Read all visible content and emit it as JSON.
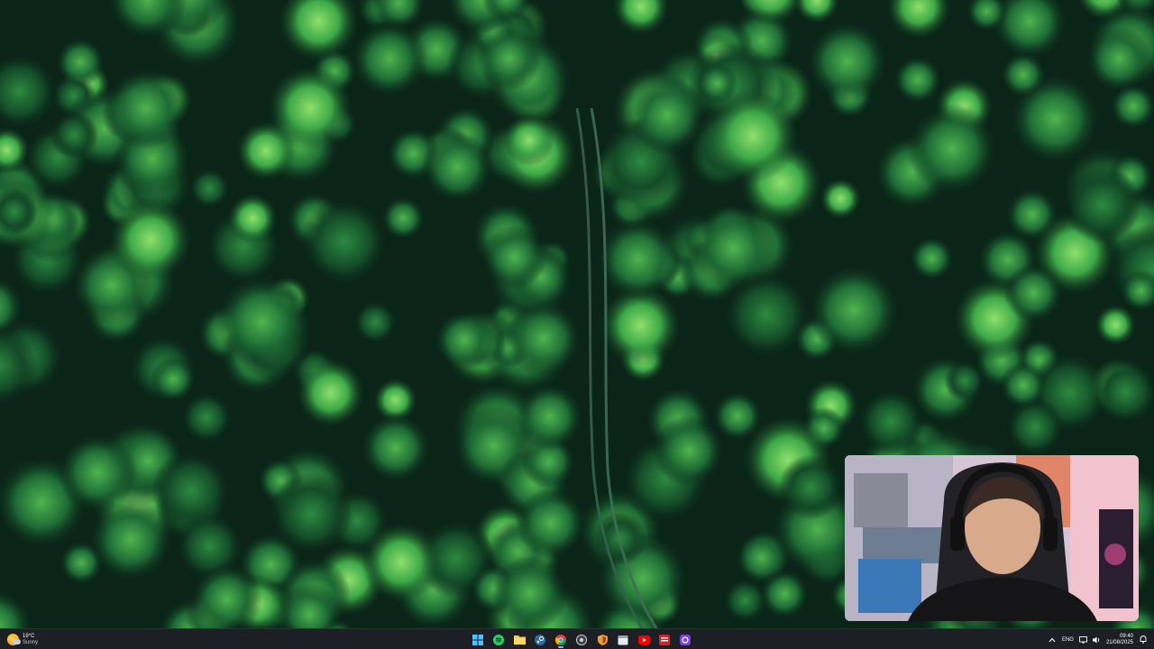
{
  "desktop": {
    "wallpaper": "aerial-forest-with-path"
  },
  "webcam": {
    "content": "streamer-webcam"
  },
  "taskbar": {
    "weather": {
      "temp": "19°C",
      "condition": "Sunny",
      "icon": "sun-cloud-icon"
    },
    "apps": [
      {
        "name": "start",
        "icon": "windows-icon"
      },
      {
        "name": "spotify",
        "icon": "spotify-icon"
      },
      {
        "name": "file-explorer",
        "icon": "folder-icon"
      },
      {
        "name": "steam",
        "icon": "steam-icon"
      },
      {
        "name": "chrome",
        "icon": "chrome-icon",
        "active": true
      },
      {
        "name": "app-circle",
        "icon": "circle-app-icon"
      },
      {
        "name": "shield-app",
        "icon": "shield-icon"
      },
      {
        "name": "calendar-app",
        "icon": "calendar-icon"
      },
      {
        "name": "youtube",
        "icon": "youtube-icon"
      },
      {
        "name": "recorder",
        "icon": "red-app-icon"
      },
      {
        "name": "discord-app",
        "icon": "purple-app-icon"
      }
    ],
    "tray": {
      "language": "ENG",
      "time": "09:40",
      "date": "21/08/2025",
      "colors": {
        "accent": "#8ab4ff",
        "taskbar_bg": "#1c2024"
      }
    }
  }
}
